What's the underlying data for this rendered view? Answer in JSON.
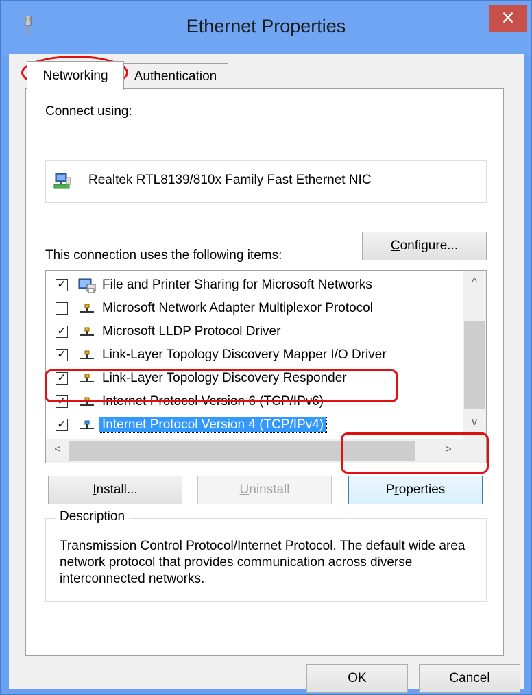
{
  "window": {
    "title": "Ethernet Properties",
    "close_glyph": "✕",
    "accent_color": "#6fa5f2",
    "close_color": "#c7504a"
  },
  "tabs": [
    {
      "label": "Networking",
      "active": true
    },
    {
      "label": "Authentication",
      "active": false
    }
  ],
  "connect_using": {
    "label": "Connect using:",
    "adapter_name": "Realtek RTL8139/810x Family Fast Ethernet NIC",
    "adapter_icon": "network-adapter-icon",
    "configure_label_pre": "",
    "configure_hotkey": "C",
    "configure_label_post": "onfigure..."
  },
  "items_section": {
    "label_pre": "This c",
    "label_hotkey": "o",
    "label_post": "nnection uses the following items:",
    "items": [
      {
        "label": "File and Printer Sharing for Microsoft Networks",
        "checked": true,
        "icon": "printer-sharing-icon",
        "selected": false
      },
      {
        "label": "Microsoft Network Adapter Multiplexor Protocol",
        "checked": false,
        "icon": "protocol-icon",
        "selected": false
      },
      {
        "label": "Microsoft LLDP Protocol Driver",
        "checked": true,
        "icon": "protocol-icon",
        "selected": false
      },
      {
        "label": "Link-Layer Topology Discovery Mapper I/O Driver",
        "checked": true,
        "icon": "protocol-icon",
        "selected": false
      },
      {
        "label": "Link-Layer Topology Discovery Responder",
        "checked": true,
        "icon": "protocol-icon",
        "selected": false
      },
      {
        "label": "Internet Protocol Version 6 (TCP/IPv6)",
        "checked": true,
        "icon": "protocol-icon",
        "selected": false
      },
      {
        "label": "Internet Protocol Version 4 (TCP/IPv4)",
        "checked": true,
        "icon": "protocol-icon",
        "selected": true
      }
    ],
    "check_glyph": "✓"
  },
  "buttons": {
    "install_hotkey": "I",
    "install_post": "nstall...",
    "uninstall_hotkey": "U",
    "uninstall_post": "ninstall",
    "properties_pre": "P",
    "properties_hotkey": "r",
    "properties_post": "operties",
    "ok": "OK",
    "cancel": "Cancel"
  },
  "description": {
    "legend": "Description",
    "text": "Transmission Control Protocol/Internet Protocol. The default wide area network protocol that provides communication across diverse interconnected networks."
  },
  "scroll": {
    "up": "^",
    "down": "v",
    "left": "<",
    "right": ">"
  }
}
